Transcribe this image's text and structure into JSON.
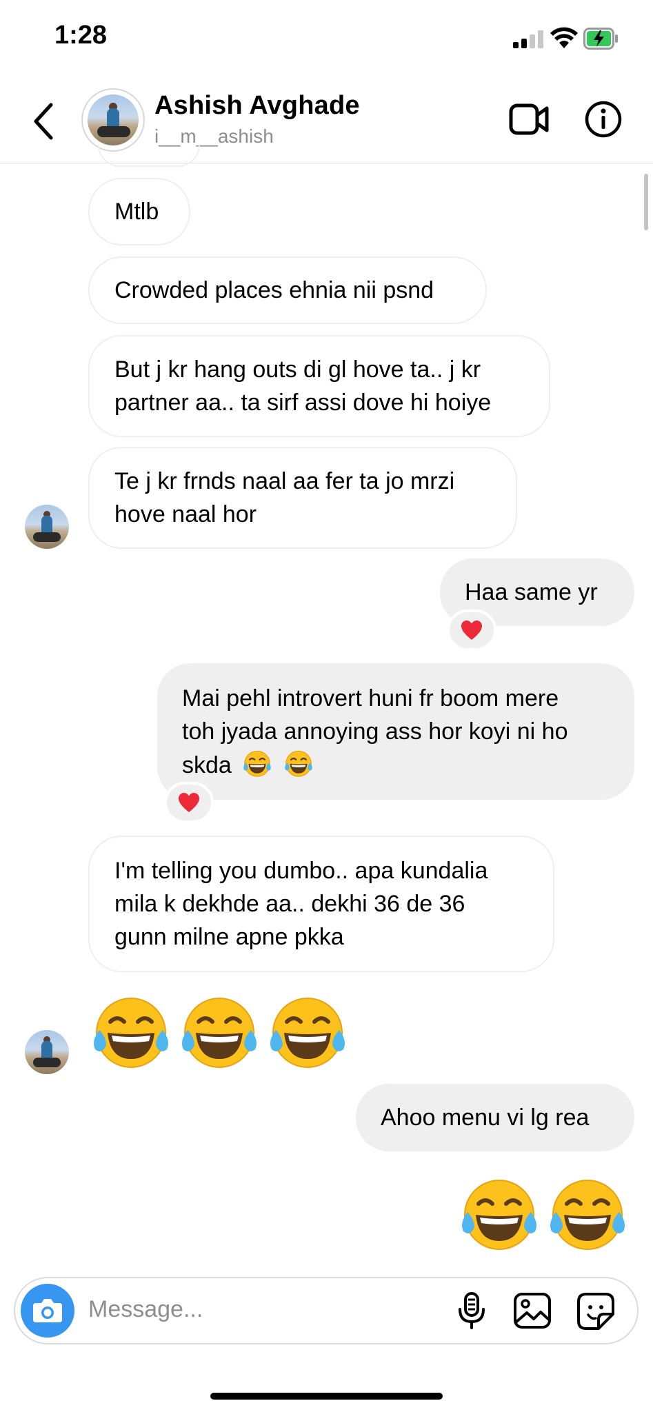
{
  "status_bar": {
    "time": "1:28"
  },
  "header": {
    "name": "Ashish Avghade",
    "username": "i__m__ashish",
    "icons": [
      "back-arrow-icon",
      "video-camera-icon",
      "info-icon"
    ]
  },
  "messages": [
    {
      "side": "in",
      "text": "Mtlb"
    },
    {
      "side": "in",
      "text": "Crowded places ehnia nii psnd"
    },
    {
      "side": "in",
      "lines": [
        "But j kr hang outs di gl hove ta.. j kr",
        "partner aa.. ta sirf assi dove hi hoiye"
      ]
    },
    {
      "side": "in",
      "lines": [
        "Te j kr frnds naal aa fer ta jo mrzi",
        "hove naal hor"
      ]
    },
    {
      "side": "out",
      "text": "Haa same yr",
      "reaction": "heart"
    },
    {
      "side": "out",
      "lines": [
        "Mai pehl introvert huni fr boom mere",
        "toh jyada annoying ass hor koyi ni ho",
        "skda"
      ],
      "emojis": 2,
      "reaction": "heart"
    },
    {
      "side": "in",
      "lines": [
        "I'm telling you dumbo.. apa kundalia",
        "mila  k dekhde aa.. dekhi 36 de 36",
        "gunn milne apne pkka"
      ]
    },
    {
      "side": "in",
      "emoji_only": 3
    },
    {
      "side": "out",
      "text": "Ahoo menu vi lg rea"
    },
    {
      "side": "out",
      "emoji_only": 2
    }
  ],
  "composer": {
    "placeholder": "Message..."
  },
  "colors": {
    "accent": "#3797f0",
    "outgoing_bubble": "#efefef",
    "heart": "#ed2939"
  }
}
